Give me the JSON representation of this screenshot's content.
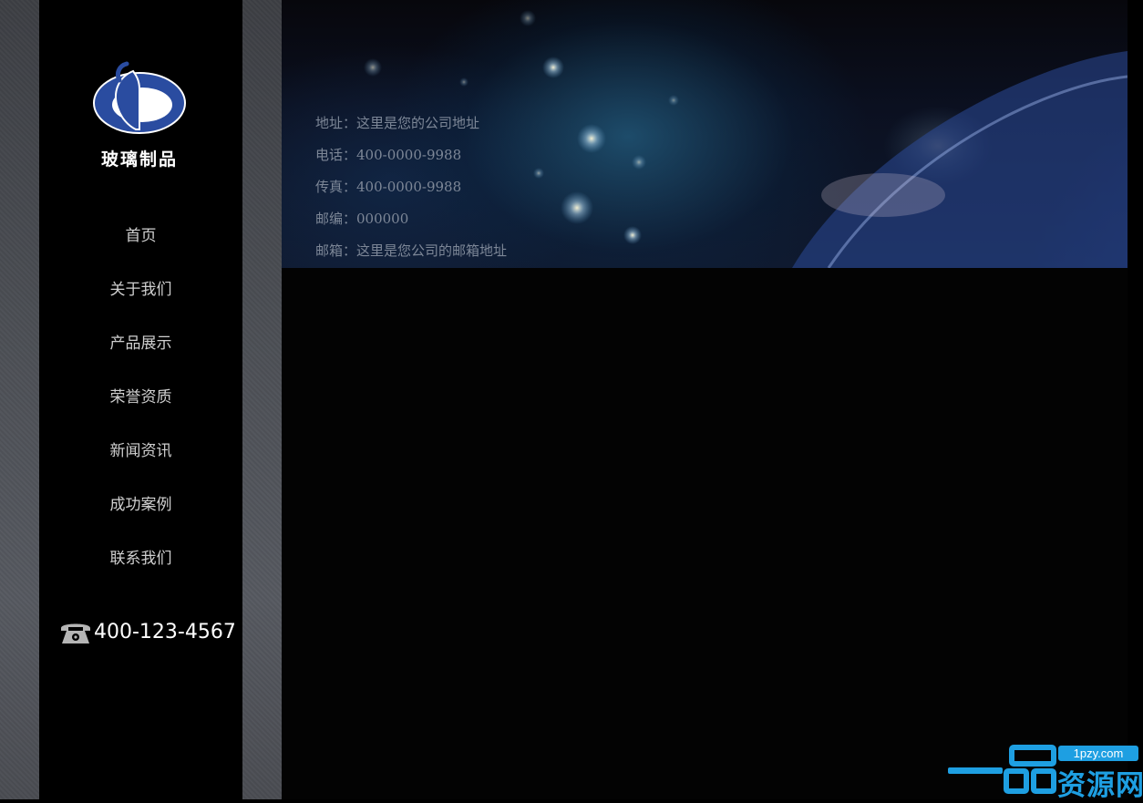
{
  "brand": {
    "logo_text": "玻璃制品",
    "colors": {
      "logo_blue": "#2a4ca0",
      "sidebar_bg": "#000000",
      "accent_watermark": "#1e9fe2"
    }
  },
  "nav": {
    "items": [
      {
        "label": "首页"
      },
      {
        "label": "关于我们"
      },
      {
        "label": "产品展示"
      },
      {
        "label": "荣誉资质"
      },
      {
        "label": "新闻资讯"
      },
      {
        "label": "成功案例"
      },
      {
        "label": "联系我们"
      }
    ]
  },
  "hotline": {
    "icon": "telephone-icon",
    "number": "400-123-4567"
  },
  "contact": {
    "address": "地址：这里是您的公司地址",
    "phone": "电话：400-0000-9988",
    "fax": "传真：400-0000-9988",
    "postcode": "邮编：000000",
    "email": "邮箱：这里是您公司的邮箱地址"
  },
  "watermark": {
    "domain": "1pzy.com",
    "text": "资源网"
  }
}
